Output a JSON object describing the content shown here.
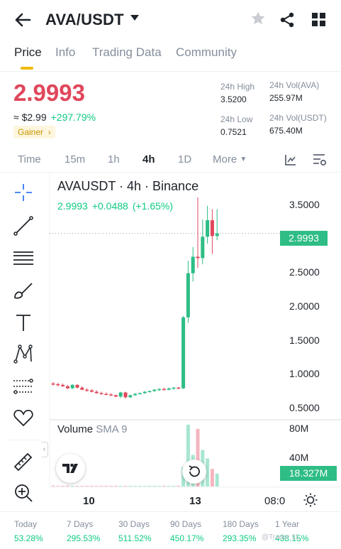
{
  "header": {
    "pair": "AVA/USDT"
  },
  "tabs": [
    {
      "label": "Price",
      "active": true
    },
    {
      "label": "Info",
      "active": false
    },
    {
      "label": "Trading Data",
      "active": false
    },
    {
      "label": "Community",
      "active": false
    }
  ],
  "price": {
    "last": "2.9993",
    "usd": "≈ $2.99",
    "change": "+297.79%",
    "badge": "Gainer"
  },
  "stats": {
    "high_label": "24h High",
    "high_value": "3.5200",
    "low_label": "24h Low",
    "low_value": "0.7521",
    "vol_base_label": "24h Vol(AVA)",
    "vol_base_value": "255.97M",
    "vol_quote_label": "24h Vol(USDT)",
    "vol_quote_value": "675.40M"
  },
  "intervals": [
    {
      "label": "Time",
      "active": false
    },
    {
      "label": "15m",
      "active": false
    },
    {
      "label": "1h",
      "active": false
    },
    {
      "label": "4h",
      "active": true
    },
    {
      "label": "1D",
      "active": false
    },
    {
      "label": "More",
      "active": false
    }
  ],
  "chart": {
    "title": "AVAUSDT · 4h · Binance",
    "last": "2.9993",
    "change": "+0.0488",
    "change_pct": "(+1.65%)",
    "y_ticks": [
      "3.5000",
      "3.0000",
      "2.5000",
      "2.0000",
      "1.5000",
      "1.0000",
      "0.5000"
    ],
    "price_tag": "2.9993",
    "volume_label": "Volume",
    "volume_sma": "SMA 9",
    "vol_ticks": [
      "80M",
      "40M"
    ],
    "vol_tag": "18.327M",
    "x_ticks": [
      "10",
      "13",
      "08:0"
    ]
  },
  "chart_data": {
    "type": "candlestick",
    "title": "AVAUSDT · 4h · Binance",
    "ylim": [
      0.45,
      3.6
    ],
    "y_ticks": [
      3.5,
      3.0,
      2.5,
      2.0,
      1.5,
      1.0,
      0.5
    ],
    "x_ticks": [
      "10",
      "13",
      "08:0"
    ],
    "colors": {
      "up": "#2ebd85",
      "down": "#e0475b"
    },
    "candles": [
      {
        "o": 0.82,
        "h": 0.84,
        "l": 0.79,
        "c": 0.81
      },
      {
        "o": 0.81,
        "h": 0.83,
        "l": 0.78,
        "c": 0.8
      },
      {
        "o": 0.8,
        "h": 0.82,
        "l": 0.77,
        "c": 0.78
      },
      {
        "o": 0.78,
        "h": 0.8,
        "l": 0.74,
        "c": 0.75
      },
      {
        "o": 0.75,
        "h": 0.81,
        "l": 0.74,
        "c": 0.8
      },
      {
        "o": 0.8,
        "h": 0.81,
        "l": 0.75,
        "c": 0.76
      },
      {
        "o": 0.76,
        "h": 0.78,
        "l": 0.72,
        "c": 0.73
      },
      {
        "o": 0.73,
        "h": 0.75,
        "l": 0.7,
        "c": 0.72
      },
      {
        "o": 0.72,
        "h": 0.74,
        "l": 0.69,
        "c": 0.7
      },
      {
        "o": 0.7,
        "h": 0.72,
        "l": 0.67,
        "c": 0.68
      },
      {
        "o": 0.68,
        "h": 0.7,
        "l": 0.66,
        "c": 0.67
      },
      {
        "o": 0.67,
        "h": 0.69,
        "l": 0.65,
        "c": 0.66
      },
      {
        "o": 0.66,
        "h": 0.68,
        "l": 0.64,
        "c": 0.65
      },
      {
        "o": 0.65,
        "h": 0.66,
        "l": 0.62,
        "c": 0.63
      },
      {
        "o": 0.63,
        "h": 0.7,
        "l": 0.61,
        "c": 0.69
      },
      {
        "o": 0.69,
        "h": 0.7,
        "l": 0.6,
        "c": 0.62
      },
      {
        "o": 0.62,
        "h": 0.66,
        "l": 0.61,
        "c": 0.65
      },
      {
        "o": 0.65,
        "h": 0.68,
        "l": 0.64,
        "c": 0.67
      },
      {
        "o": 0.67,
        "h": 0.69,
        "l": 0.66,
        "c": 0.68
      },
      {
        "o": 0.68,
        "h": 0.71,
        "l": 0.67,
        "c": 0.7
      },
      {
        "o": 0.7,
        "h": 0.72,
        "l": 0.69,
        "c": 0.71
      },
      {
        "o": 0.71,
        "h": 0.74,
        "l": 0.7,
        "c": 0.73
      },
      {
        "o": 0.73,
        "h": 0.75,
        "l": 0.71,
        "c": 0.74
      },
      {
        "o": 0.74,
        "h": 0.76,
        "l": 0.72,
        "c": 0.73
      },
      {
        "o": 0.73,
        "h": 0.76,
        "l": 0.72,
        "c": 0.75
      },
      {
        "o": 0.75,
        "h": 0.77,
        "l": 0.73,
        "c": 0.76
      },
      {
        "o": 0.76,
        "h": 0.77,
        "l": 0.74,
        "c": 0.75
      },
      {
        "o": 0.75,
        "h": 1.8,
        "l": 0.74,
        "c": 1.78
      },
      {
        "o": 1.78,
        "h": 2.6,
        "l": 1.7,
        "c": 2.42
      },
      {
        "o": 2.42,
        "h": 2.8,
        "l": 2.3,
        "c": 2.66
      },
      {
        "o": 2.66,
        "h": 3.52,
        "l": 2.5,
        "c": 2.64
      },
      {
        "o": 2.64,
        "h": 3.2,
        "l": 2.55,
        "c": 2.95
      },
      {
        "o": 2.95,
        "h": 3.4,
        "l": 2.85,
        "c": 3.19
      },
      {
        "o": 3.19,
        "h": 3.35,
        "l": 2.7,
        "c": 2.96
      },
      {
        "o": 2.96,
        "h": 3.35,
        "l": 2.9,
        "c": 2.9993
      }
    ],
    "volume": {
      "ylim": [
        0,
        95
      ],
      "ticks": [
        80,
        40
      ],
      "values": [
        1.2,
        0.9,
        0.8,
        1.3,
        1.0,
        0.9,
        0.8,
        0.7,
        0.8,
        0.6,
        0.7,
        0.6,
        0.5,
        0.6,
        0.9,
        0.8,
        0.6,
        0.7,
        0.6,
        0.8,
        0.7,
        0.9,
        0.8,
        0.7,
        0.8,
        0.9,
        0.8,
        28,
        88,
        45,
        82,
        52,
        40,
        25,
        18.327
      ],
      "sma9_tag": 18.327
    }
  },
  "performance": [
    {
      "label": "Today",
      "value": "53.28%"
    },
    {
      "label": "7 Days",
      "value": "295.53%"
    },
    {
      "label": "30 Days",
      "value": "511.52%"
    },
    {
      "label": "90 Days",
      "value": "450.17%"
    },
    {
      "label": "180 Days",
      "value": "293.35%"
    },
    {
      "label": "1 Year",
      "value": "438.15%"
    }
  ],
  "watermark": "@Trader 11"
}
